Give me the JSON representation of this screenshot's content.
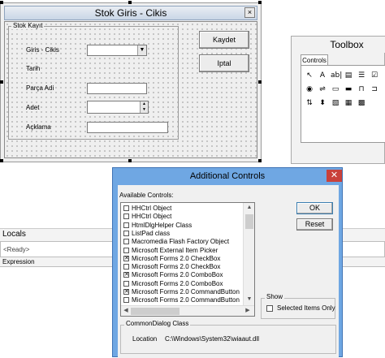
{
  "form": {
    "title": "Stok Giris - Cikis",
    "frame_caption": "Stok Kayıt",
    "labels": [
      "Giris - Cikis",
      "Tarih",
      "Parça Adi",
      "Adet",
      "Açklama"
    ],
    "save_button": "Kaydet",
    "cancel_button": "Iptal",
    "close_glyph": "×"
  },
  "toolbox": {
    "title": "Toolbox",
    "tab": "Controls",
    "tools": [
      {
        "name": "pointer-icon",
        "glyph": "↖"
      },
      {
        "name": "label-icon",
        "glyph": "A"
      },
      {
        "name": "textbox-icon",
        "glyph": "ab|"
      },
      {
        "name": "combobox-icon",
        "glyph": "▤"
      },
      {
        "name": "listbox-icon",
        "glyph": "☰"
      },
      {
        "name": "checkbox-icon",
        "glyph": "☑"
      },
      {
        "name": "optionbutton-icon",
        "glyph": "◉"
      },
      {
        "name": "togglebutton-icon",
        "glyph": "⇌"
      },
      {
        "name": "frame-icon",
        "glyph": "▭"
      },
      {
        "name": "commandbutton-icon",
        "glyph": "▬"
      },
      {
        "name": "tabstrip-icon",
        "glyph": "⊓"
      },
      {
        "name": "multipage-icon",
        "glyph": "⊐"
      },
      {
        "name": "scrollbar-icon",
        "glyph": "⇅"
      },
      {
        "name": "spinbutton-icon",
        "glyph": "⬍"
      },
      {
        "name": "image-icon",
        "glyph": "▧"
      },
      {
        "name": "refedit-icon",
        "glyph": "▦"
      },
      {
        "name": "extra-control-icon",
        "glyph": "▩"
      }
    ]
  },
  "locals": {
    "title": "Locals",
    "ready": "<Ready>",
    "column": "Expression"
  },
  "dialog": {
    "title": "Additional Controls",
    "close_glyph": "✕",
    "available_label": "Available Controls:",
    "items": [
      {
        "label": "HHCtrl Object",
        "checked": false,
        "selected": false
      },
      {
        "label": "HHCtrl Object",
        "checked": false,
        "selected": false
      },
      {
        "label": "HtmlDlgHelper Class",
        "checked": false,
        "selected": false
      },
      {
        "label": "ListPad class",
        "checked": false,
        "selected": false
      },
      {
        "label": "Macromedia Flash Factory Object",
        "checked": false,
        "selected": false
      },
      {
        "label": "Microsoft External Item Picker",
        "checked": false,
        "selected": false
      },
      {
        "label": "Microsoft Forms 2.0 CheckBox",
        "checked": true,
        "selected": false
      },
      {
        "label": "Microsoft Forms 2.0 CheckBox",
        "checked": false,
        "selected": false
      },
      {
        "label": "Microsoft Forms 2.0 ComboBox",
        "checked": true,
        "selected": false
      },
      {
        "label": "Microsoft Forms 2.0 ComboBox",
        "checked": false,
        "selected": false
      },
      {
        "label": "Microsoft Forms 2.0 CommandButton",
        "checked": true,
        "selected": false
      },
      {
        "label": "Microsoft Forms 2.0 CommandButton",
        "checked": false,
        "selected": false
      }
    ],
    "ok_button": "OK",
    "reset_button": "Reset",
    "show_group": "Show",
    "selected_only": "Selected Items Only",
    "info_group": "CommonDialog Class",
    "location_label": "Location",
    "location_value": "C:\\Windows\\System32\\wiaaut.dll"
  },
  "colors": {
    "dialog_frame": "#6fa7e3",
    "close_red": "#c9413b",
    "selection": "#3366cc"
  }
}
